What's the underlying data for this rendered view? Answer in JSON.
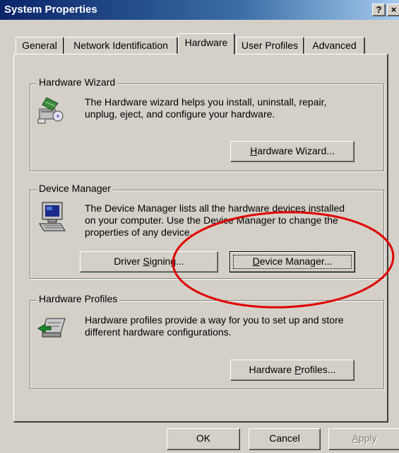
{
  "window": {
    "title": "System Properties",
    "help_button": "?",
    "close_button": "×"
  },
  "tabs": [
    {
      "label": "General",
      "active": false
    },
    {
      "label": "Network Identification",
      "active": false
    },
    {
      "label": "Hardware",
      "active": true
    },
    {
      "label": "User Profiles",
      "active": false
    },
    {
      "label": "Advanced",
      "active": false
    }
  ],
  "hardware_wizard": {
    "group_label": "Hardware Wizard",
    "description_line1": "The Hardware wizard helps you install, uninstall, repair,",
    "description_line2": "unplug, eject, and configure your hardware.",
    "button_pre": "",
    "button_mnemonic": "H",
    "button_post": "ardware Wizard..."
  },
  "device_manager": {
    "group_label": "Device Manager",
    "description_line1": "The Device Manager lists all the hardware devices installed",
    "description_line2": "on your computer. Use the Device Manager to change the",
    "description_line3": "properties of any device.",
    "driver_signing_pre": "Driver ",
    "driver_signing_mnemonic": "S",
    "driver_signing_post": "igning...",
    "button_pre": "",
    "button_mnemonic": "D",
    "button_post": "evice Manager..."
  },
  "hardware_profiles": {
    "group_label": "Hardware Profiles",
    "description_line1": "Hardware profiles provide a way for you to set up and store",
    "description_line2": "different hardware configurations.",
    "button_pre": "Hardware ",
    "button_mnemonic": "P",
    "button_post": "rofiles..."
  },
  "footer": {
    "ok": "OK",
    "cancel": "Cancel",
    "apply_mnemonic": "A",
    "apply_post": "pply"
  },
  "icons": {
    "hardware_wizard": "hardware-wizard-icon",
    "device_manager": "computer-icon",
    "hardware_profiles": "hardware-profile-icon"
  },
  "colors": {
    "title_bar_start": "#0a246a",
    "title_bar_end": "#a6caf0",
    "dialog_face": "#d4d0c8",
    "annotation_ellipse": "#e00000"
  }
}
